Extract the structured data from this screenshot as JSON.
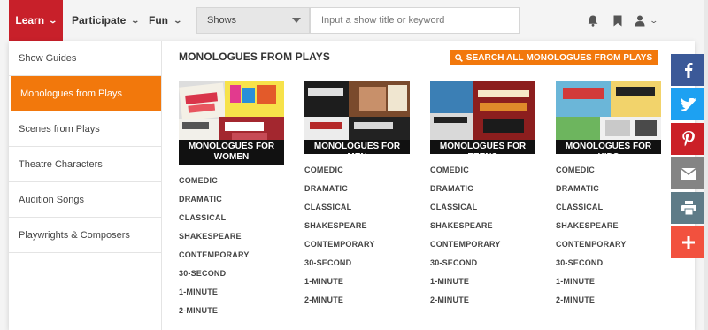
{
  "nav": {
    "learn": "Learn",
    "participate": "Participate",
    "fun": "Fun",
    "shows_select": "Shows",
    "search_placeholder": "Input a show title or keyword"
  },
  "sidebar": {
    "items": [
      {
        "label": "Show Guides",
        "active": false
      },
      {
        "label": "Monologues from Plays",
        "active": true
      },
      {
        "label": "Scenes from Plays",
        "active": false
      },
      {
        "label": "Theatre Characters",
        "active": false
      },
      {
        "label": "Audition Songs",
        "active": false
      },
      {
        "label": "Playwrights & Composers",
        "active": false
      }
    ]
  },
  "main": {
    "title": "MONOLOGUES FROM PLAYS",
    "search_all_button": "SEARCH ALL MONOLOGUES FROM PLAYS",
    "columns": [
      {
        "image_label": "MONOLOGUES FOR WOMEN",
        "links": [
          "COMEDIC",
          "DRAMATIC",
          "CLASSICAL",
          "SHAKESPEARE",
          "CONTEMPORARY",
          "30-SECOND",
          "1-MINUTE",
          "2-MINUTE"
        ]
      },
      {
        "image_label": "MONOLOGUES FOR MEN",
        "links": [
          "COMEDIC",
          "DRAMATIC",
          "CLASSICAL",
          "SHAKESPEARE",
          "CONTEMPORARY",
          "30-SECOND",
          "1-MINUTE",
          "2-MINUTE"
        ]
      },
      {
        "image_label": "MONOLOGUES FOR TEENS",
        "links": [
          "COMEDIC",
          "DRAMATIC",
          "CLASSICAL",
          "SHAKESPEARE",
          "CONTEMPORARY",
          "30-SECOND",
          "1-MINUTE",
          "2-MINUTE"
        ]
      },
      {
        "image_label": "MONOLOGUES FOR KIDS",
        "links": [
          "COMEDIC",
          "DRAMATIC",
          "CLASSICAL",
          "SHAKESPEARE",
          "CONTEMPORARY",
          "30-SECOND",
          "1-MINUTE",
          "2-MINUTE"
        ]
      }
    ]
  },
  "share": [
    {
      "icon": "facebook-icon",
      "color": "#3b5998"
    },
    {
      "icon": "twitter-icon",
      "color": "#1da1f2"
    },
    {
      "icon": "pinterest-icon",
      "color": "#cb2027"
    },
    {
      "icon": "email-icon",
      "color": "#848484"
    },
    {
      "icon": "print-icon",
      "color": "#5e7b87"
    },
    {
      "icon": "more-icon",
      "color": "#f2513e"
    }
  ],
  "colors": {
    "brand_red": "#c8202a",
    "accent_orange": "#f2780c"
  }
}
